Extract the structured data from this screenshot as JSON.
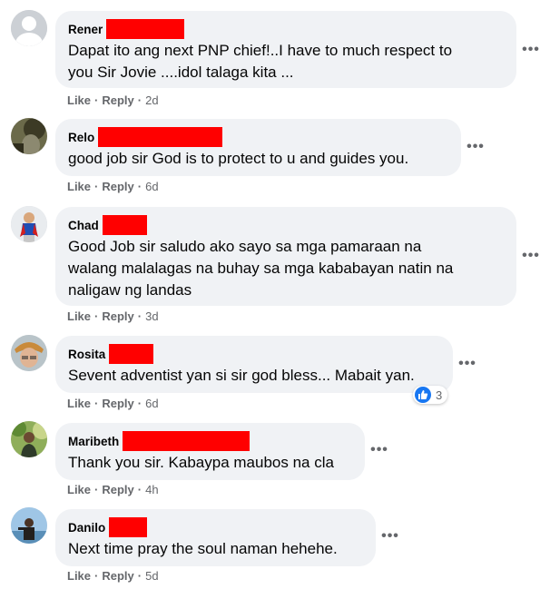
{
  "comments": [
    {
      "name": "Rener",
      "text": "Dapat ito ang next PNP chief!..I have to much respect to you Sir Jovie ....idol talaga kita ...",
      "line1": "Dapat ito ang next PNP chief!..I have to much respect to",
      "line2": "you Sir Jovie ....idol talaga kita ...",
      "like": "Like",
      "reply": "Reply",
      "time": "2d"
    },
    {
      "name": "Relo",
      "text": "good job sir God is to protect to u and guides you.",
      "like": "Like",
      "reply": "Reply",
      "time": "6d"
    },
    {
      "name": "Chad",
      "line1": "Good Job sir saludo ako sayo sa mga pamaraan na",
      "line2": "walang malalagas na buhay sa mga kababayan natin na",
      "line3": "naligaw ng landas",
      "like": "Like",
      "reply": "Reply",
      "time": "3d"
    },
    {
      "name": "Rosita",
      "text": "Sevent adventist yan si sir god bless... Mabait yan.",
      "like": "Like",
      "reply": "Reply",
      "time": "6d",
      "reaction_count": "3"
    },
    {
      "name": "Maribeth",
      "text": "Thank you sir. Kabaypa maubos na cla",
      "like": "Like",
      "reply": "Reply",
      "time": "4h"
    },
    {
      "name": "Danilo",
      "text": "Next time pray the soul naman hehehe.",
      "like": "Like",
      "reply": "Reply",
      "time": "5d"
    }
  ],
  "separator": "·",
  "more_icon": "more-options-icon",
  "colors": {
    "bubble": "#f0f2f5",
    "meta": "#65676b",
    "redaction": "#ff0000",
    "like_blue": "#1877f2"
  }
}
